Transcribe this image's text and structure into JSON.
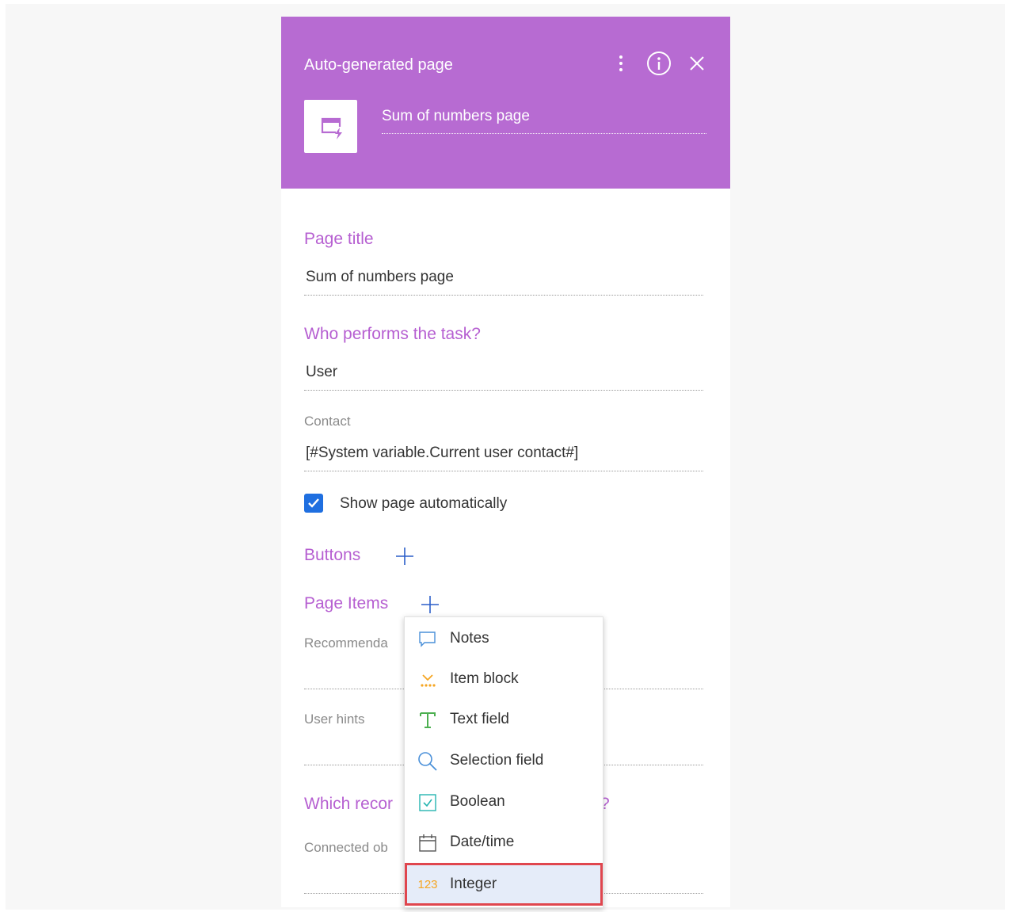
{
  "header": {
    "title": "Auto-generated page",
    "page_name": "Sum of numbers page"
  },
  "form": {
    "page_title_label": "Page title",
    "page_title_value": "Sum of numbers page",
    "performer_label": "Who performs the task?",
    "performer_value": "User",
    "contact_label": "Contact",
    "contact_value": "[#System variable.Current user contact#]",
    "show_automatically_label": "Show page automatically",
    "show_automatically_checked": true,
    "buttons_label": "Buttons",
    "page_items_label": "Page Items",
    "recommendations_label": "Recommenda",
    "user_hints_label": "User hints",
    "which_record_label": "Which recor",
    "which_record_suffix": "?",
    "connected_label": "Connected ob"
  },
  "menu": {
    "items": [
      {
        "label": "Notes",
        "icon": "notes-icon"
      },
      {
        "label": "Item block",
        "icon": "item-block-icon"
      },
      {
        "label": "Text field",
        "icon": "text-field-icon"
      },
      {
        "label": "Selection field",
        "icon": "search-icon"
      },
      {
        "label": "Boolean",
        "icon": "checkbox-icon"
      },
      {
        "label": "Date/time",
        "icon": "calendar-icon"
      },
      {
        "label": "Integer",
        "icon": "integer-icon",
        "icon_text": "123"
      }
    ],
    "selected_index": 6
  },
  "colors": {
    "header_bg": "#b76bd2",
    "accent_purple": "#b65fd1",
    "checkbox_blue": "#1f6fe0",
    "highlight_red": "#e0464e",
    "selected_bg": "#e5ecf9"
  }
}
